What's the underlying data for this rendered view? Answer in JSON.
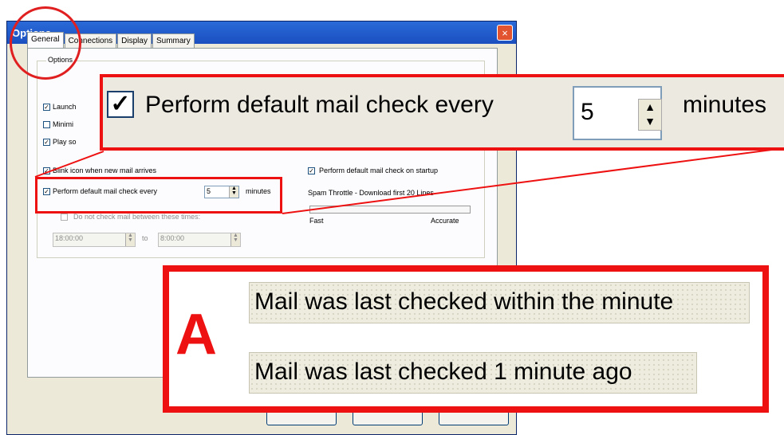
{
  "window": {
    "title": "Options",
    "close_glyph": "×"
  },
  "tabs": [
    "General",
    "Connections",
    "Display",
    "Summary"
  ],
  "options_group": {
    "label": "Options",
    "launch_partial": "Launch",
    "minimize_partial": "Minimi",
    "play_partial": "Play so",
    "blink_label": "Blink icon when new mail arrives",
    "perform_label": "Perform default mail check every",
    "perform_value": "5",
    "minutes_label": "minutes",
    "do_not_check_label": "Do not check mail between these times:",
    "time_from": "18:00:00",
    "time_to_label": "to",
    "time_to": "8:00:00",
    "startup_label": "Perform default mail check on startup",
    "spam_label": "Spam Throttle - Download first 20 Lines",
    "slider_left": "Fast",
    "slider_right": "Accurate"
  },
  "zoom_callout": {
    "label": "Perform default mail check every",
    "value": "5",
    "unit": "minutes"
  },
  "callout_a": {
    "letter": "A",
    "status_1": "Mail was last checked within the minute",
    "status_2": "Mail was last checked 1 minute ago"
  },
  "colors": {
    "highlight": "#ee1111",
    "titlebar": "#1b4fc0",
    "dialog_bg": "#ece9d8"
  },
  "icons": [
    "close-icon",
    "checkbox-checked-icon",
    "spinner-arrows-icon"
  ]
}
